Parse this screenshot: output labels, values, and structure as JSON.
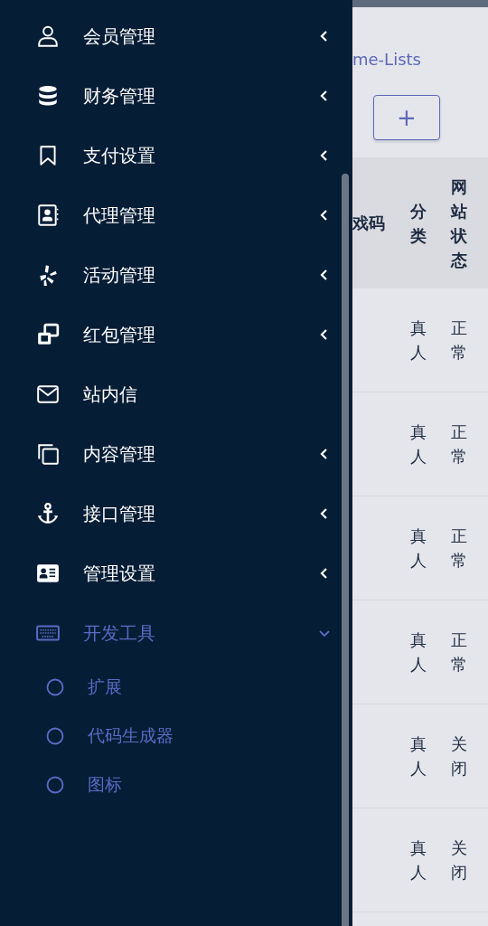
{
  "sidebar": {
    "items": [
      {
        "label": "会员管理",
        "has_submenu": true,
        "expanded": false
      },
      {
        "label": "财务管理",
        "has_submenu": true,
        "expanded": false
      },
      {
        "label": "支付设置",
        "has_submenu": true,
        "expanded": false
      },
      {
        "label": "代理管理",
        "has_submenu": true,
        "expanded": false
      },
      {
        "label": "活动管理",
        "has_submenu": true,
        "expanded": false
      },
      {
        "label": "红包管理",
        "has_submenu": true,
        "expanded": false
      },
      {
        "label": "站内信",
        "has_submenu": false,
        "expanded": false
      },
      {
        "label": "内容管理",
        "has_submenu": true,
        "expanded": false
      },
      {
        "label": "接口管理",
        "has_submenu": true,
        "expanded": false
      },
      {
        "label": "管理设置",
        "has_submenu": true,
        "expanded": false
      },
      {
        "label": "开发工具",
        "has_submenu": true,
        "expanded": true,
        "children": [
          {
            "label": "扩展",
            "selected": false
          },
          {
            "label": "代码生成器",
            "selected": false
          },
          {
            "label": "图标",
            "selected": false
          }
        ]
      }
    ]
  },
  "breadcrumb": "me-Lists",
  "add_button": "+",
  "table": {
    "columns": [
      "戏码",
      "分类",
      "网站状态"
    ],
    "rows": [
      {
        "category": "真人",
        "site_status": "正常"
      },
      {
        "category": "真人",
        "site_status": "正常"
      },
      {
        "category": "真人",
        "site_status": "正常"
      },
      {
        "category": "真人",
        "site_status": "正常"
      },
      {
        "category": "真人",
        "site_status": "关闭"
      },
      {
        "category": "真人",
        "site_status": "关闭"
      }
    ]
  }
}
